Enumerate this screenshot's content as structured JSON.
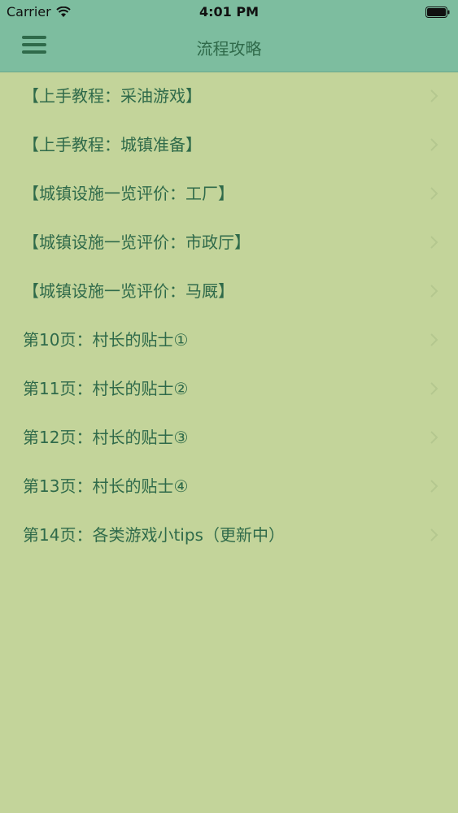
{
  "status_bar": {
    "carrier": "Carrier",
    "time": "4:01 PM"
  },
  "nav": {
    "title": "流程攻略"
  },
  "list": {
    "items": [
      "【上手教程：采油游戏】",
      "【上手教程：城镇准备】",
      "【城镇设施一览评价：工厂】",
      "【城镇设施一览评价：市政厅】",
      "【城镇设施一览评价：马厩】",
      "第10页：村长的贴士①",
      "第11页：村长的贴士②",
      "第12页：村长的贴士③",
      "第13页：村长的贴士④",
      "第14页：各类游戏小tips（更新中）"
    ]
  },
  "colors": {
    "background": "#c3d49a",
    "nav_bar": "#7dbd9f",
    "text": "#2f6a4a",
    "chevron": "#b4c78f"
  },
  "icons": {
    "menu": "hamburger-menu-icon",
    "row_arrow": "chevron-right-icon"
  }
}
